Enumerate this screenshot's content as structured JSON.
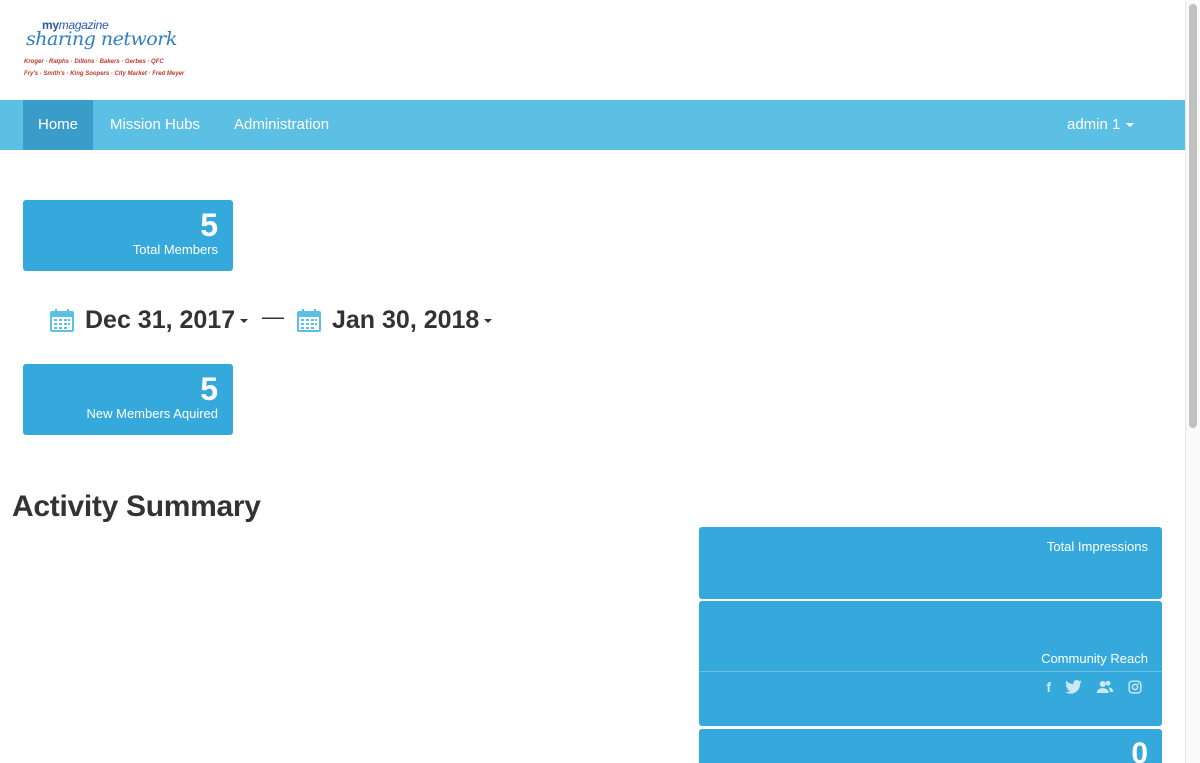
{
  "logo": {
    "my": "my",
    "magazine": "magazine",
    "title": "sharing network",
    "brands_line1": "Kroger · Ralphs · Dillons · Bakers · Gerbes · QFC",
    "brands_line2": "Fry's · Smith's · King Soopers · City Market · Fred Meyer"
  },
  "nav": {
    "items": [
      {
        "label": "Home",
        "active": true
      },
      {
        "label": "Mission Hubs",
        "active": false
      },
      {
        "label": "Administration",
        "active": false
      }
    ],
    "user": "admin 1"
  },
  "stats": {
    "total_members": {
      "value": "5",
      "label": "Total Members"
    },
    "new_members": {
      "value": "5",
      "label": "New Members Aquired"
    }
  },
  "date_range": {
    "start": "Dec 31, 2017",
    "separator": "—",
    "end": "Jan 30, 2018"
  },
  "activity": {
    "title": "Activity Summary",
    "total_impressions_label": "Total Impressions",
    "community_reach_label": "Community Reach",
    "social_icons": [
      "facebook-icon",
      "twitter-icon",
      "community-icon",
      "instagram-icon"
    ],
    "third_value": "0"
  },
  "colors": {
    "navbar": "#5bc0e4",
    "nav_active": "#3a9dc9",
    "tile": "#36a9dc"
  }
}
